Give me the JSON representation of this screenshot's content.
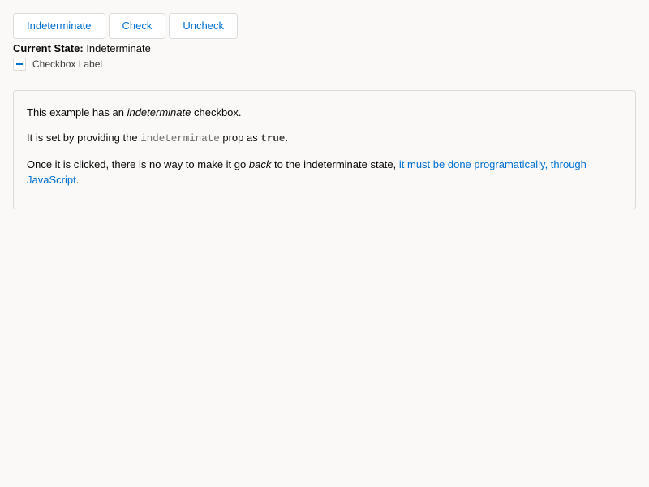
{
  "buttons": {
    "indeterminate_label": "Indeterminate",
    "check_label": "Check",
    "uncheck_label": "Uncheck"
  },
  "state": {
    "label": "Current State:",
    "value": "Indeterminate"
  },
  "checkbox": {
    "label": "Checkbox Label",
    "status": "indeterminate"
  },
  "info": {
    "p1_prefix": "This example has an",
    "p1_emphasis": "indeterminate",
    "p1_suffix": "checkbox.",
    "p2_prefix": "It is set by providing the",
    "p2_code": "indeterminate",
    "p2_middle": "prop as",
    "p2_value": "true",
    "p2_suffix": ".",
    "p3_prefix": "Once it is clicked, there is no way to make it go",
    "p3_emphasis": "back",
    "p3_middle": "to the indeterminate state,",
    "p3_link": "it must be done programatically, through JavaScript",
    "p3_suffix": "."
  },
  "colors": {
    "accent": "#0070d2",
    "background": "#faf9f8",
    "border": "#dddbda"
  }
}
